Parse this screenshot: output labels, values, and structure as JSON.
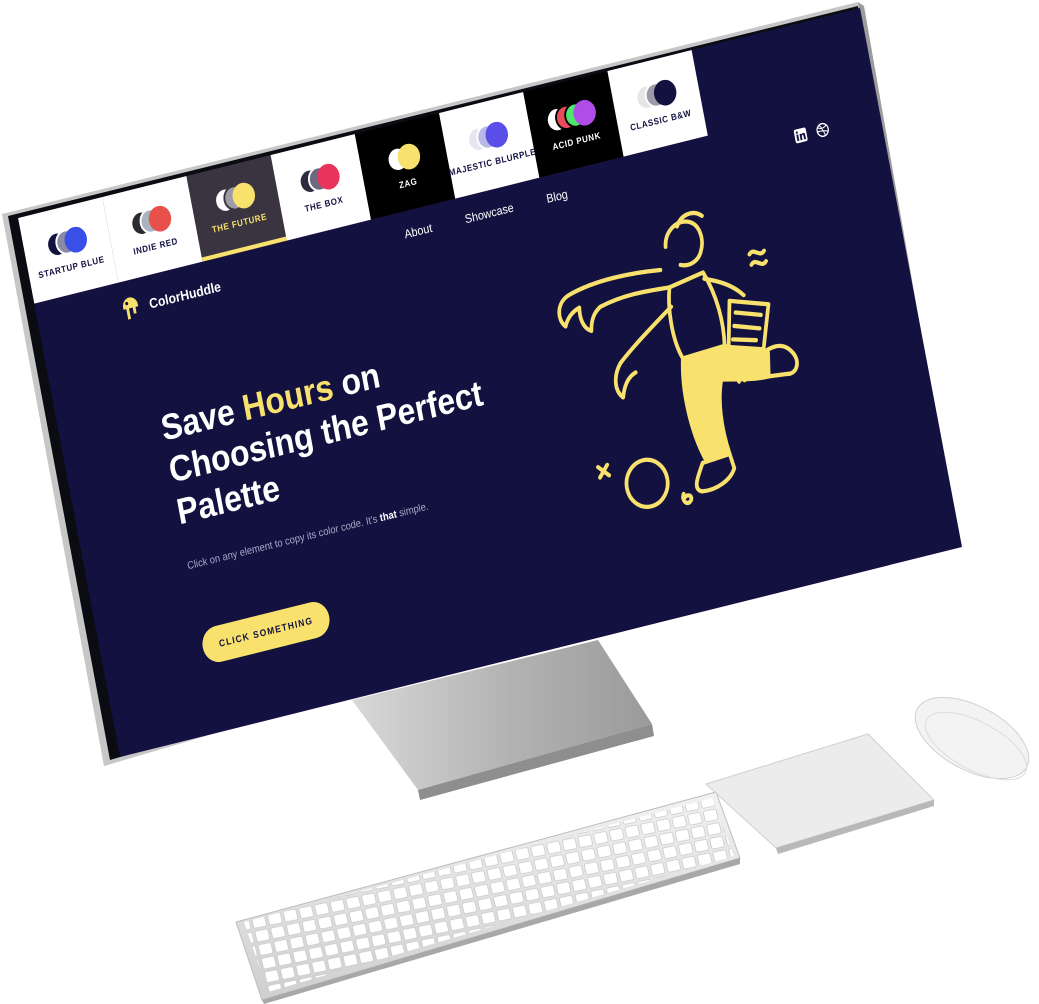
{
  "brand": {
    "name": "ColorHuddle"
  },
  "palettes": [
    {
      "label": "Startup Blue",
      "theme": "light",
      "colors": [
        "#12113f",
        "#8a8aa8",
        "#3a4fe8"
      ]
    },
    {
      "label": "Indie Red",
      "theme": "light",
      "colors": [
        "#2b2a33",
        "#a8b4bf",
        "#e8504b"
      ]
    },
    {
      "label": "The Future",
      "theme": "active",
      "colors": [
        "#ffffff",
        "#9c9ca8",
        "#f8e16c"
      ]
    },
    {
      "label": "The Box",
      "theme": "light",
      "colors": [
        "#2b2a3f",
        "#6b6a7f",
        "#e8335a"
      ]
    },
    {
      "label": "Zag",
      "theme": "dark",
      "colors": [
        "#ffffff",
        "#f8e16c"
      ]
    },
    {
      "label": "Majestic Blurple",
      "theme": "light",
      "colors": [
        "#e6e6f2",
        "#b9b9e8",
        "#5b4de8"
      ]
    },
    {
      "label": "Acid Punk",
      "theme": "dark",
      "colors": [
        "#ffffff",
        "#e84b5a",
        "#4de86b",
        "#b04de8"
      ]
    },
    {
      "label": "Classic B&W",
      "theme": "light",
      "colors": [
        "#e6e6e6",
        "#9c9ca8",
        "#12113f"
      ]
    }
  ],
  "nav": {
    "about": "About",
    "showcase": "Showcase",
    "blog": "Blog"
  },
  "social": {
    "linkedin": "in"
  },
  "hero": {
    "title_pre": "Save ",
    "title_highlight": "Hours",
    "title_post": " on Choosing the Perfect Palette",
    "subtitle_pre": "Click on any element to copy its color code. It's ",
    "subtitle_bold": "that",
    "subtitle_post": " simple.",
    "cta": "Click Something"
  },
  "colors": {
    "background": "#12113f",
    "accent": "#f8e16c",
    "text": "#ffffff",
    "muted": "#a9a8c8"
  },
  "icons": {
    "brand": "drip-logo-icon",
    "linkedin": "linkedin-icon",
    "dribbble": "dribbble-icon"
  }
}
